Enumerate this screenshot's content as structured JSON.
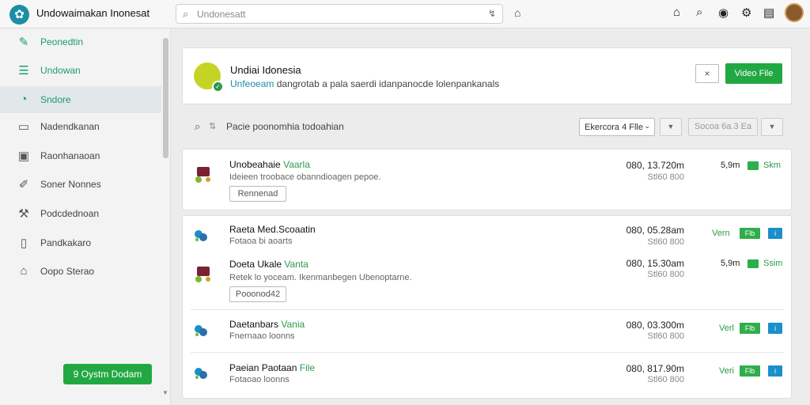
{
  "topbar": {
    "app_title": "Undowaimakan Inonesat",
    "search_placeholder": "Undonesatt"
  },
  "sidebar": {
    "items": [
      {
        "label": "Peonedtin",
        "icon": "edit-icon"
      },
      {
        "label": "Undowan",
        "icon": "list-icon"
      },
      {
        "label": "Sndore",
        "icon": "clock-icon"
      },
      {
        "label": "Nadendkanan",
        "icon": "document-icon"
      },
      {
        "label": "Raonhanaoan",
        "icon": "image-icon"
      },
      {
        "label": "Soner Nonnes",
        "icon": "pen-icon"
      },
      {
        "label": "Podcdednoan",
        "icon": "wrench-icon"
      },
      {
        "label": "Pandkakaro",
        "icon": "page-icon"
      },
      {
        "label": "Oopo Sterao",
        "icon": "home-icon"
      }
    ],
    "cta_label": "9 Oystm Dodam"
  },
  "header": {
    "title": "Undiai Idonesia",
    "subtitle_link": "Unfeoeam",
    "subtitle_rest": "dangrotab a pala saerdi idanpanocde lolenpankanals",
    "close_label": "×",
    "video_label": "Video File"
  },
  "filter": {
    "label": "Pacie poonomhia todoahian",
    "select_value": "Ekercora 4 Flle",
    "button2_label": "Socoa 6a.3 Ea"
  },
  "rows": [
    {
      "name": "Unobeahaie",
      "name_hl": "Vaarla",
      "desc": "Ideieen troobace obanndioagen pepoe.",
      "button": "Rennenad",
      "amount": "080, 13.720m",
      "amount2": "Stl60 800",
      "price": "5,9m",
      "status": "Skm"
    },
    {
      "name": "Raeta Med.Scoaatin",
      "name_hl": "",
      "desc": "Fotaoa bi aoarts",
      "amount": "080, 05.28am",
      "amount2": "Stl60 800",
      "version": "Vern",
      "tag": "Flb",
      "info": "i"
    },
    {
      "name": "Doeta Ukale",
      "name_hl": "Vanta",
      "desc": "Retek lo yoceam. Ikenmanbegen Ubenoptarne.",
      "button": "Pooonod42",
      "amount": "080, 15.30am",
      "amount2": "Stl60 800",
      "price": "5,9m",
      "status": "Ssim"
    },
    {
      "name": "Daetanbars",
      "name_hl": "Vania",
      "desc": "Fnernaao loonns",
      "amount": "080, 03.300m",
      "amount2": "Stl60 800",
      "version": "Verl",
      "tag": "Flb",
      "info": "i"
    },
    {
      "name": "Paeian Paotaan",
      "name_hl": "File",
      "desc": "Fotaoao loonns",
      "amount": "080, 817.90m",
      "amount2": "Stl60 800",
      "version": "Veri",
      "tag": "Flb",
      "info": "i"
    }
  ]
}
